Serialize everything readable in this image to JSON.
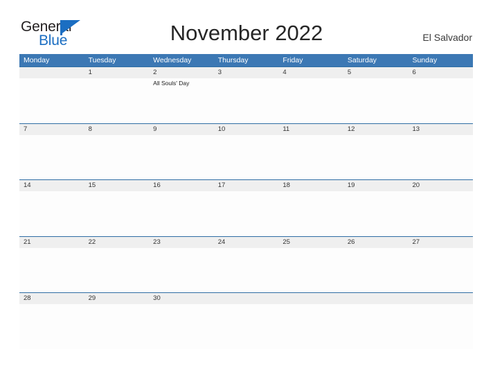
{
  "brand": {
    "name_part1": "General",
    "name_part2": "Blue",
    "flag_icon": "blue-flag-icon",
    "color_dark": "#231f20",
    "color_blue": "#1b6ec2"
  },
  "header": {
    "title": "November 2022",
    "region": "El Salvador"
  },
  "calendar": {
    "accent_color": "#3c78b4",
    "band_color": "#efefef",
    "weekdays": [
      "Monday",
      "Tuesday",
      "Wednesday",
      "Thursday",
      "Friday",
      "Saturday",
      "Sunday"
    ],
    "weeks": [
      {
        "days": [
          {
            "num": "",
            "event": ""
          },
          {
            "num": "1",
            "event": ""
          },
          {
            "num": "2",
            "event": "All Souls' Day"
          },
          {
            "num": "3",
            "event": ""
          },
          {
            "num": "4",
            "event": ""
          },
          {
            "num": "5",
            "event": ""
          },
          {
            "num": "6",
            "event": ""
          }
        ]
      },
      {
        "days": [
          {
            "num": "7",
            "event": ""
          },
          {
            "num": "8",
            "event": ""
          },
          {
            "num": "9",
            "event": ""
          },
          {
            "num": "10",
            "event": ""
          },
          {
            "num": "11",
            "event": ""
          },
          {
            "num": "12",
            "event": ""
          },
          {
            "num": "13",
            "event": ""
          }
        ]
      },
      {
        "days": [
          {
            "num": "14",
            "event": ""
          },
          {
            "num": "15",
            "event": ""
          },
          {
            "num": "16",
            "event": ""
          },
          {
            "num": "17",
            "event": ""
          },
          {
            "num": "18",
            "event": ""
          },
          {
            "num": "19",
            "event": ""
          },
          {
            "num": "20",
            "event": ""
          }
        ]
      },
      {
        "days": [
          {
            "num": "21",
            "event": ""
          },
          {
            "num": "22",
            "event": ""
          },
          {
            "num": "23",
            "event": ""
          },
          {
            "num": "24",
            "event": ""
          },
          {
            "num": "25",
            "event": ""
          },
          {
            "num": "26",
            "event": ""
          },
          {
            "num": "27",
            "event": ""
          }
        ]
      },
      {
        "days": [
          {
            "num": "28",
            "event": ""
          },
          {
            "num": "29",
            "event": ""
          },
          {
            "num": "30",
            "event": ""
          },
          {
            "num": "",
            "event": ""
          },
          {
            "num": "",
            "event": ""
          },
          {
            "num": "",
            "event": ""
          },
          {
            "num": "",
            "event": ""
          }
        ]
      }
    ]
  }
}
